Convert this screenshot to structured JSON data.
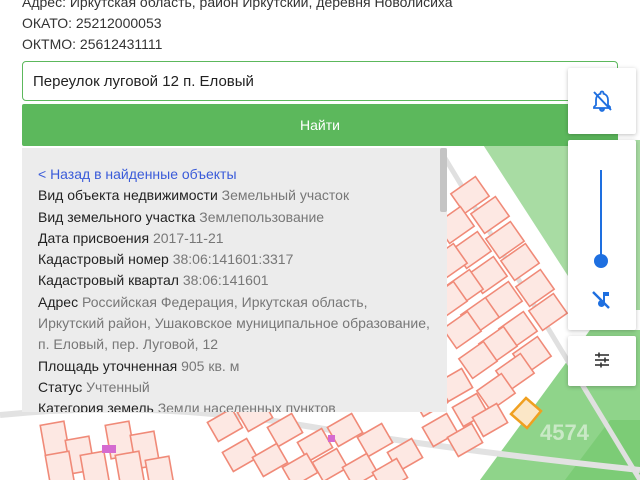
{
  "info": {
    "address_line": "Адрес: Иркутская область, район Иркутский, деревня Новолисиха",
    "okato": "ОКАТО: 25212000053",
    "oktmo": "ОКТМО: 25612431111"
  },
  "search": {
    "value": "Переулок луговой 12 п. Еловый",
    "button_label": "Найти"
  },
  "details": {
    "back_link": "< Назад в найденные объекты",
    "rows": [
      {
        "label": "Вид объекта недвижимости",
        "value": "Земельный участок"
      },
      {
        "label": "Вид земельного участка",
        "value": "Землепользование"
      },
      {
        "label": "Дата присвоения",
        "value": "2017-11-21"
      },
      {
        "label": "Кадастровый номер",
        "value": "38:06:141601:3317"
      },
      {
        "label": "Кадастровый квартал",
        "value": "38:06:141601"
      },
      {
        "label": "Адрес",
        "value": "Российская Федерация, Иркутская область, Иркутский район, Ушаковское муниципальное образование, п. Еловый, пер. Луговой, 12"
      },
      {
        "label": "Площадь уточненная",
        "value": "905 кв. м"
      },
      {
        "label": "Статус",
        "value": "Учтенный"
      },
      {
        "label": "Категория земель",
        "value": "Земли населенных пунктов"
      }
    ]
  },
  "map": {
    "watermark_number": "4574",
    "colors": {
      "parcel_stroke": "#f08a78",
      "parcel_fill": "#fde3dd",
      "selected_parcel": "#f0a020",
      "green_zone": "#8fd48a",
      "accent": "#5cb85c",
      "control_blue": "#1e6fe0"
    }
  },
  "controls": {
    "notifications_icon": "bell-off-icon",
    "layer_icon": "music-off-icon",
    "filter_icon": "sliders-icon"
  }
}
